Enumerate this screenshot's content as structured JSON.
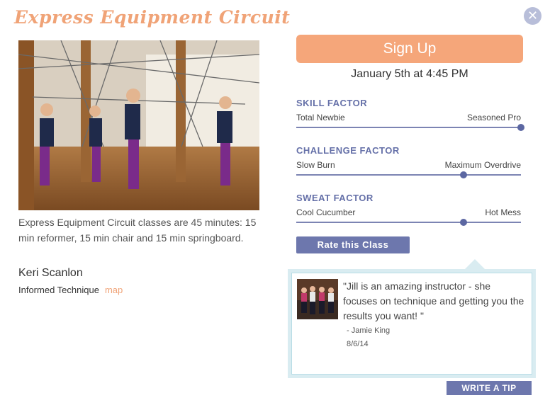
{
  "header": {
    "title": "Express Equipment Circuit"
  },
  "class_info": {
    "description": "Express Equipment Circuit classes are 45 minutes: 15 min reformer, 15 min chair and 15 min springboard.",
    "instructor": "Keri Scanlon",
    "studio": "Informed Technique",
    "map_label": "map"
  },
  "booking": {
    "signup_label": "Sign Up",
    "datetime": "January 5th at 4:45 PM"
  },
  "factors": [
    {
      "title": "SKILL FACTOR",
      "low": "Total Newbie",
      "high": "Seasoned Pro",
      "level": 1.0
    },
    {
      "title": "CHALLENGE FACTOR",
      "low": "Slow Burn",
      "high": "Maximum Overdrive",
      "level": 0.745
    },
    {
      "title": "SWEAT FACTOR",
      "low": "Cool Cucumber",
      "high": "Hot Mess",
      "level": 0.745
    }
  ],
  "rate_label": "Rate this Class",
  "tip": {
    "quote": "\"Jill is an amazing instructor - she focuses on technique and getting you the results you want! \"",
    "author": "- Jamie King",
    "date": "8/6/14"
  },
  "write_tip_label": "WRITE A TIP",
  "icons": {
    "close": "close-x-icon"
  },
  "colors": {
    "accent_orange": "#f5a67a",
    "accent_blue": "#6d77ad",
    "title_orange": "#f0a377"
  }
}
